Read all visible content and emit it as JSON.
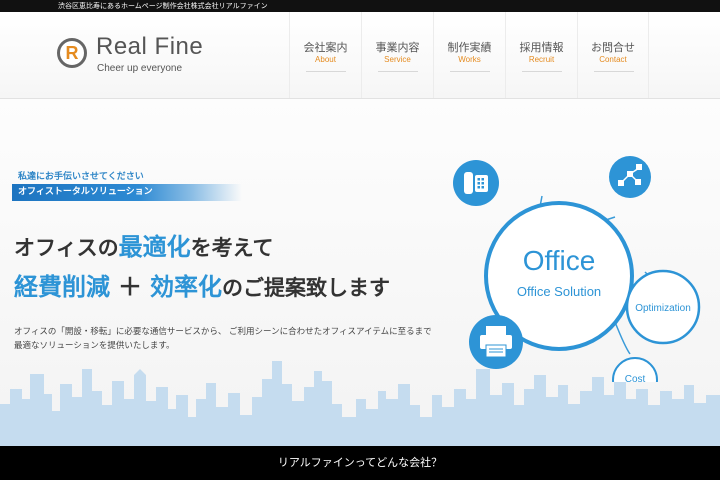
{
  "topbar": {
    "text": "渋谷区恵比寿にあるホームページ制作会社株式会社リアルファイン"
  },
  "logo": {
    "mark": "R",
    "name": "Real Fine",
    "tagline": "Cheer up everyone"
  },
  "nav": [
    {
      "jp": "会社案内",
      "en": "About"
    },
    {
      "jp": "事業内容",
      "en": "Service"
    },
    {
      "jp": "制作実績",
      "en": "Works"
    },
    {
      "jp": "採用情報",
      "en": "Recruit"
    },
    {
      "jp": "お問合せ",
      "en": "Contact"
    }
  ],
  "hero": {
    "small_text": "私達にお手伝いさせてください",
    "ribbon_text": "オフィストータルソリューション",
    "line1_prefix": "オフィスの",
    "line1_accent": "最適化",
    "line1_suffix": "を考えて",
    "line2_part1": "経費削減",
    "line2_plus": "＋",
    "line2_part2": "効率化",
    "line2_suffix": "のご提案致します",
    "desc_line1": "オフィスの「開設・移転」に必要な通信サービスから、 ご利用シーンに合わせたオフィスアイテムに至るまで",
    "desc_line2": "最適なソリューションを提供いたします。"
  },
  "diagram": {
    "center_title": "Office",
    "center_sub": "Office Solution",
    "optimization": "Optimization",
    "cost": "Cost",
    "icons": [
      "phone-icon",
      "network-icon",
      "fax-icon"
    ]
  },
  "footer": {
    "question": "リアルファインってどんな会社？"
  },
  "colors": {
    "accent_blue": "#2d94d6",
    "accent_orange": "#e58b1f",
    "skyline": "#c5dcef"
  }
}
